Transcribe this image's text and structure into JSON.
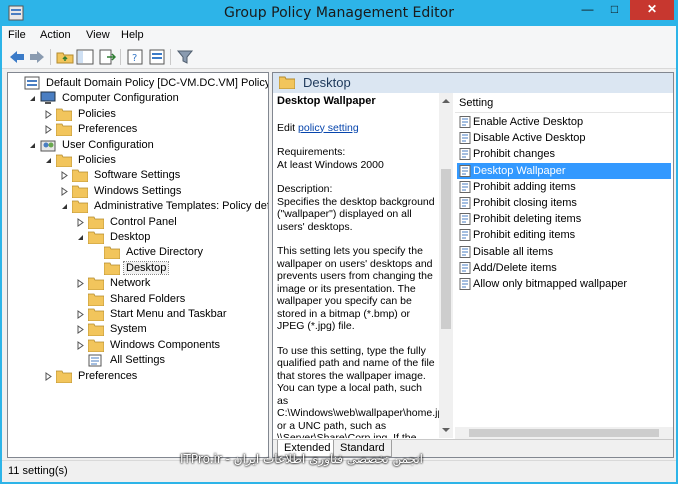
{
  "window": {
    "title": "Group Policy Management Editor"
  },
  "menu": [
    "File",
    "Action",
    "View",
    "Help"
  ],
  "tree": [
    {
      "label": "Default Domain Policy [DC-VM.DC.VM] Policy",
      "icon": "gpo-icon",
      "expander": "none"
    },
    {
      "label": "Computer Configuration",
      "icon": "computer-icon",
      "expander": "expanded"
    },
    {
      "label": "Policies",
      "icon": "folder-icon",
      "expander": "collapsed"
    },
    {
      "label": "Preferences",
      "icon": "folder-icon",
      "expander": "collapsed"
    },
    {
      "label": "User Configuration",
      "icon": "user-config-icon",
      "expander": "expanded"
    },
    {
      "label": "Policies",
      "icon": "folder-icon",
      "expander": "expanded"
    },
    {
      "label": "Software Settings",
      "icon": "folder-icon",
      "expander": "collapsed"
    },
    {
      "label": "Windows Settings",
      "icon": "folder-icon",
      "expander": "collapsed"
    },
    {
      "label": "Administrative Templates: Policy definition",
      "icon": "folder-icon",
      "expander": "expanded"
    },
    {
      "label": "Control Panel",
      "icon": "folder-icon",
      "expander": "collapsed"
    },
    {
      "label": "Desktop",
      "icon": "folder-icon",
      "expander": "expanded"
    },
    {
      "label": "Active Directory",
      "icon": "folder-icon",
      "expander": "none"
    },
    {
      "label": "Desktop",
      "icon": "folder-icon",
      "expander": "none",
      "selected": true
    },
    {
      "label": "Network",
      "icon": "folder-icon",
      "expander": "collapsed"
    },
    {
      "label": "Shared Folders",
      "icon": "folder-icon",
      "expander": "none"
    },
    {
      "label": "Start Menu and Taskbar",
      "icon": "folder-icon",
      "expander": "collapsed"
    },
    {
      "label": "System",
      "icon": "folder-icon",
      "expander": "collapsed"
    },
    {
      "label": "Windows Components",
      "icon": "folder-icon",
      "expander": "collapsed"
    },
    {
      "label": "All Settings",
      "icon": "all-settings-icon",
      "expander": "none"
    },
    {
      "label": "Preferences",
      "icon": "folder-icon",
      "expander": "collapsed"
    }
  ],
  "right": {
    "header": "Desktop",
    "desc_title": "Desktop Wallpaper",
    "edit_prefix": "Edit",
    "edit_link": "policy setting",
    "requirements_label": "Requirements:",
    "requirements_value": "At least Windows 2000",
    "description_label": "Description:",
    "description_text": "Specifies the desktop background (\"wallpaper\") displayed on all users' desktops.",
    "para2": "This setting lets you specify the wallpaper on users' desktops and prevents users from changing the image or its presentation. The wallpaper you specify can be stored in a bitmap (*.bmp) or JPEG (*.jpg) file.",
    "para3": "To use this setting, type the fully qualified path and name of the file that stores the wallpaper image. You can type a local path, such as C:\\Windows\\web\\wallpaper\\home.jpg or a UNC path, such as \\\\Server\\Share\\Corp.jpg. If the",
    "column_header": "Setting",
    "settings": [
      "Enable Active Desktop",
      "Disable Active Desktop",
      "Prohibit changes",
      "Desktop Wallpaper",
      "Prohibit adding items",
      "Prohibit closing items",
      "Prohibit deleting items",
      "Prohibit editing items",
      "Disable all items",
      "Add/Delete items",
      "Allow only bitmapped wallpaper"
    ],
    "selected_setting": 3,
    "tabs": [
      "Extended",
      "Standard"
    ]
  },
  "watermark": "ITPro.ir - انجمن تخصصی فناوری اطلاعات ایران",
  "status": "11 setting(s)",
  "colors": {
    "titlebar": "#2db4e8",
    "selection": "#3399ff",
    "header": "#dbe6f2",
    "close": "#c7372f",
    "folder": "#f2c55c"
  }
}
